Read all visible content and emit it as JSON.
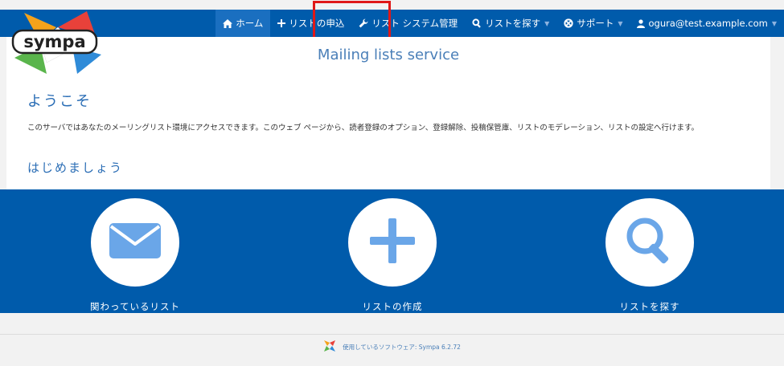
{
  "nav": {
    "items": [
      {
        "label": "ホーム",
        "icon": "home-icon",
        "active": true
      },
      {
        "label": "リストの申込",
        "icon": "plus-icon"
      },
      {
        "label": "リスト システム管理",
        "icon": "wrench-icon"
      },
      {
        "label": "リストを探す",
        "icon": "search-icon",
        "dropdown": true
      },
      {
        "label": "サポート",
        "icon": "lifebuoy-icon",
        "dropdown": true
      },
      {
        "label": "ogura@test.example.com",
        "icon": "user-icon",
        "dropdown": true
      }
    ]
  },
  "logo": {
    "text": "sympa"
  },
  "header": {
    "title": "Mailing lists service"
  },
  "welcome": {
    "heading": "ようこそ",
    "text": "このサーバではあなたのメーリングリスト環境にアクセスできます。このウェブ ページから、読者登録のオプション、登録解除、投稿保管庫、リストのモデレーション、リストの設定へ行けます。"
  },
  "start": {
    "heading": "はじめましょう"
  },
  "actions": [
    {
      "label": "関わっているリスト",
      "icon": "envelope-icon"
    },
    {
      "label": "リストの作成",
      "icon": "plus-icon"
    },
    {
      "label": "リストを探す",
      "icon": "search-icon"
    }
  ],
  "footer": {
    "text": "使用しているソフトウェア: Sympa 6.2.72"
  },
  "colors": {
    "primary": "#005bab",
    "highlight": "#e01818",
    "accent": "#6aa6e8"
  }
}
